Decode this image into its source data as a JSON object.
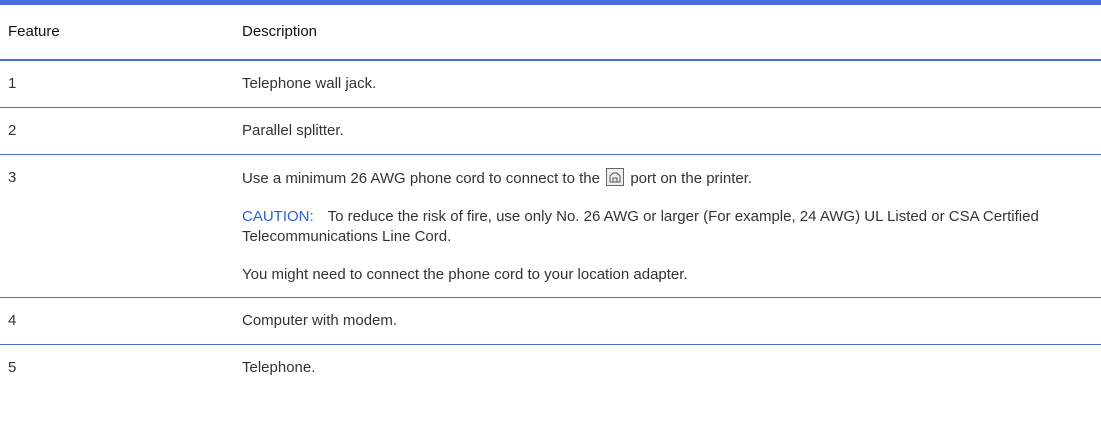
{
  "table": {
    "headers": {
      "feature": "Feature",
      "description": "Description"
    },
    "rows": [
      {
        "feature": "1",
        "description": "Telephone wall jack."
      },
      {
        "feature": "2",
        "description": "Parallel splitter."
      },
      {
        "feature": "3",
        "description_before_icon": "Use a minimum 26 AWG phone cord to connect to the",
        "description_icon": "fax-port-icon",
        "description_after_icon": "port on the printer.",
        "caution_label": "CAUTION:",
        "caution_text": "To reduce the risk of fire, use only No. 26 AWG or larger (For example, 24 AWG) UL Listed or CSA Certified Telecommunications Line Cord.",
        "note": "You might need to connect the phone cord to your location adapter."
      },
      {
        "feature": "4",
        "description": "Computer with modem."
      },
      {
        "feature": "5",
        "description": "Telephone."
      }
    ]
  },
  "colors": {
    "rule": "#4a6ee0",
    "caution": "#2b5fd9"
  }
}
